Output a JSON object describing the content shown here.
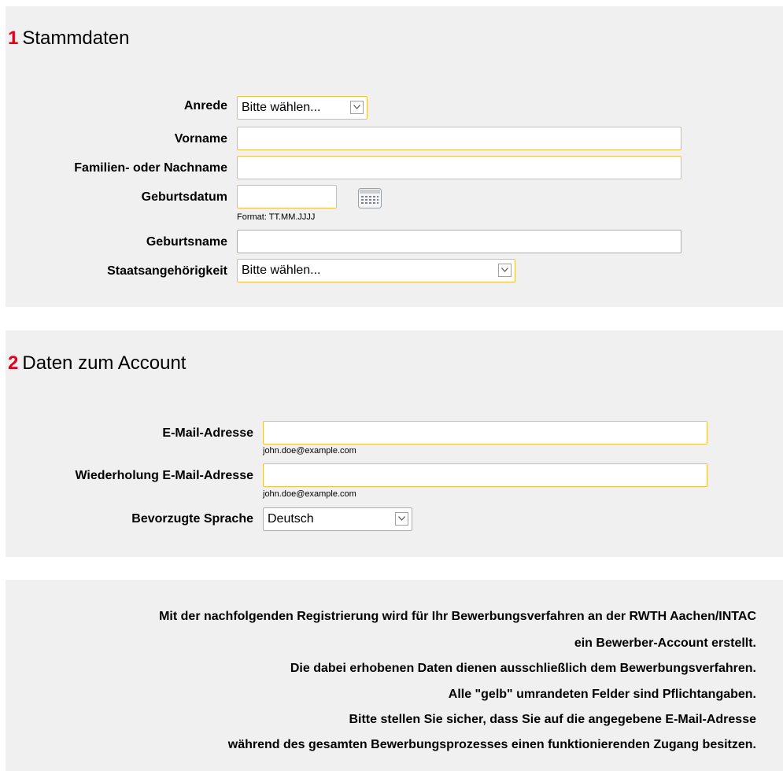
{
  "stammdaten": {
    "number": "1",
    "title": "Stammdaten",
    "anrede": {
      "label": "Anrede",
      "value": "Bitte wählen..."
    },
    "vorname": {
      "label": "Vorname",
      "value": ""
    },
    "nachname": {
      "label": "Familien- oder Nachname",
      "value": ""
    },
    "geburtsdatum": {
      "label": "Geburtsdatum",
      "value": "",
      "hint": "Format: TT.MM.JJJJ"
    },
    "geburtsname": {
      "label": "Geburtsname",
      "value": ""
    },
    "staatsangehoerigkeit": {
      "label": "Staatsangehörigkeit",
      "value": "Bitte wählen..."
    }
  },
  "account": {
    "number": "2",
    "title": "Daten zum Account",
    "email": {
      "label": "E-Mail-Adresse",
      "value": "",
      "hint": "john.doe@example.com"
    },
    "email_repeat": {
      "label": "Wiederholung E-Mail-Adresse",
      "value": "",
      "hint": "john.doe@example.com"
    },
    "sprache": {
      "label": "Bevorzugte Sprache",
      "value": "Deutsch"
    }
  },
  "info": {
    "lines": [
      "Mit der nachfolgenden Registrierung wird für Ihr Bewerbungsverfahren an der RWTH Aachen/INTAC",
      "ein Bewerber-Account erstellt.",
      "Die dabei erhobenen Daten dienen ausschließlich dem Bewerbungsverfahren.",
      "Alle \"gelb\" umrandeten Felder sind Pflichtangaben.",
      "Bitte stellen Sie sicher, dass Sie auf die angegebene E-Mail-Adresse",
      "während des gesamten Bewerbungsprozesses einen funktionierenden Zugang besitzen."
    ]
  },
  "colors": {
    "accent_red": "#e3001b",
    "required_border": "#f0c040",
    "panel_bg": "#f0f0f0"
  },
  "icons": {
    "calendar": "calendar-icon",
    "dropdown": "chevron-down-icon"
  }
}
